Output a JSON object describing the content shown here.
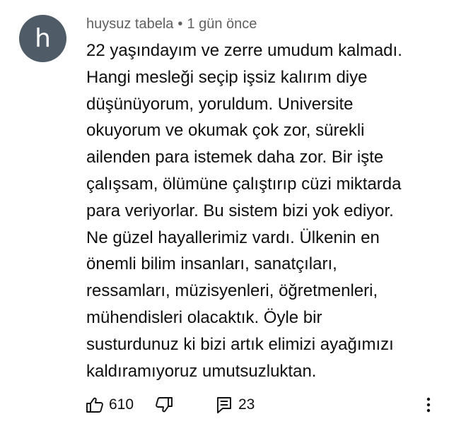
{
  "comment": {
    "avatar_letter": "h",
    "author": "huysuz tabela",
    "separator": "•",
    "time": "1 gün önce",
    "lines": [
      "22 yaşındayım ve zerre umudum kalmadı.",
      "Hangi mesleği seçip işsiz kalırım diye",
      "düşünüyorum, yoruldum. Universite",
      "okuyorum ve okumak çok zor, sürekli",
      "ailenden para istemek daha zor. Bir işte",
      "çalışsam, ölümüne çalıştırıp cüzi miktarda",
      "para veriyorlar. Bu sistem bizi yok ediyor.",
      "Ne güzel hayallerimiz vardı. Ülkenin en",
      "önemli bilim insanları, sanatçıları,",
      "ressamları, müzisyenleri, öğretmenleri,",
      "mühendisleri olacaktık. Öyle bir",
      "susturdunuz ki bizi artık elimizi ayağımızı",
      "kaldıramıyoruz umutsuzluktan."
    ],
    "like_count": "610",
    "reply_count": "23"
  },
  "icons": {
    "like": "thumbs-up-icon",
    "dislike": "thumbs-down-icon",
    "reply": "reply-comment-icon",
    "more": "more-vertical-icon"
  },
  "colors": {
    "avatar_bg": "#4f5b67",
    "meta_text": "#606060",
    "body_text": "#0f0f0f"
  }
}
